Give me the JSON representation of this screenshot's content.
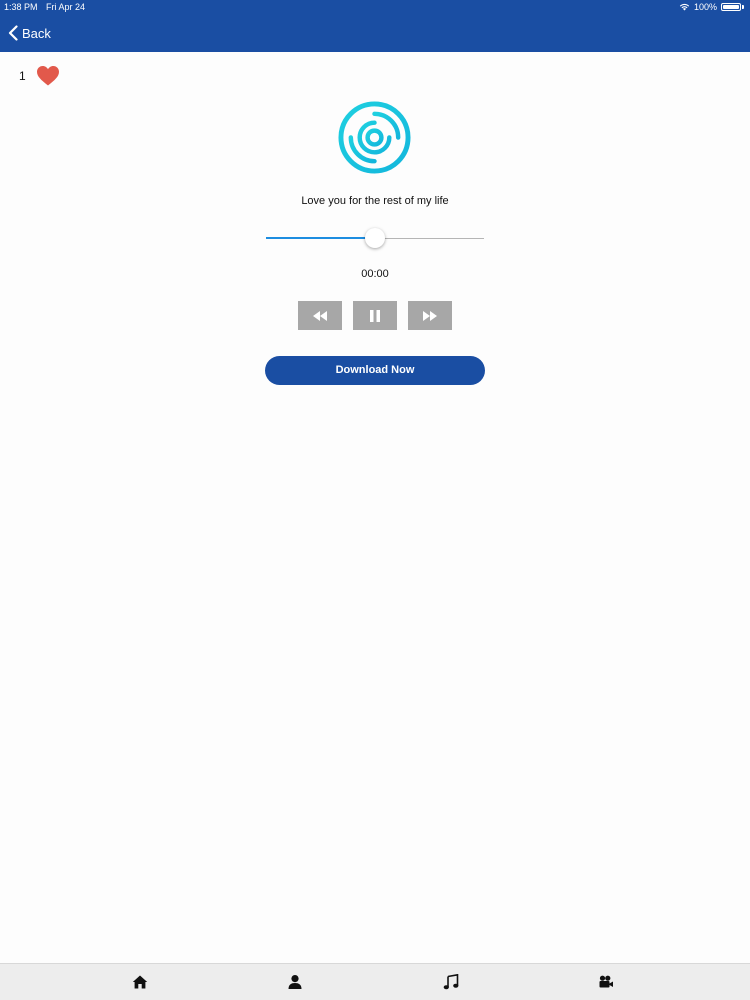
{
  "status_bar": {
    "time": "1:38 PM",
    "date": "Fri Apr 24",
    "battery": "100%",
    "icons": [
      "wifi-icon",
      "battery-icon"
    ]
  },
  "nav": {
    "back_label": "Back",
    "back_icon": "chevron-left-icon"
  },
  "likes": {
    "count": "1",
    "icon": "heart-icon",
    "icon_color": "#e2594b"
  },
  "player": {
    "artwork_icon": "disc-icon",
    "artwork_color": "#19c3df",
    "track_title": "Love you for the rest of my life",
    "progress_fraction": 0.5,
    "elapsed": "00:00",
    "controls": [
      {
        "icon": "rewind-icon"
      },
      {
        "icon": "pause-icon"
      },
      {
        "icon": "fast-forward-icon"
      }
    ]
  },
  "download_label": "Download Now",
  "tabs": [
    {
      "icon": "home-icon"
    },
    {
      "icon": "user-icon"
    },
    {
      "icon": "music-note-icon"
    },
    {
      "icon": "video-camera-icon"
    }
  ],
  "colors": {
    "brand": "#1a4ea3",
    "accent": "#1d8de0",
    "control_bg": "#a7a7a7"
  }
}
